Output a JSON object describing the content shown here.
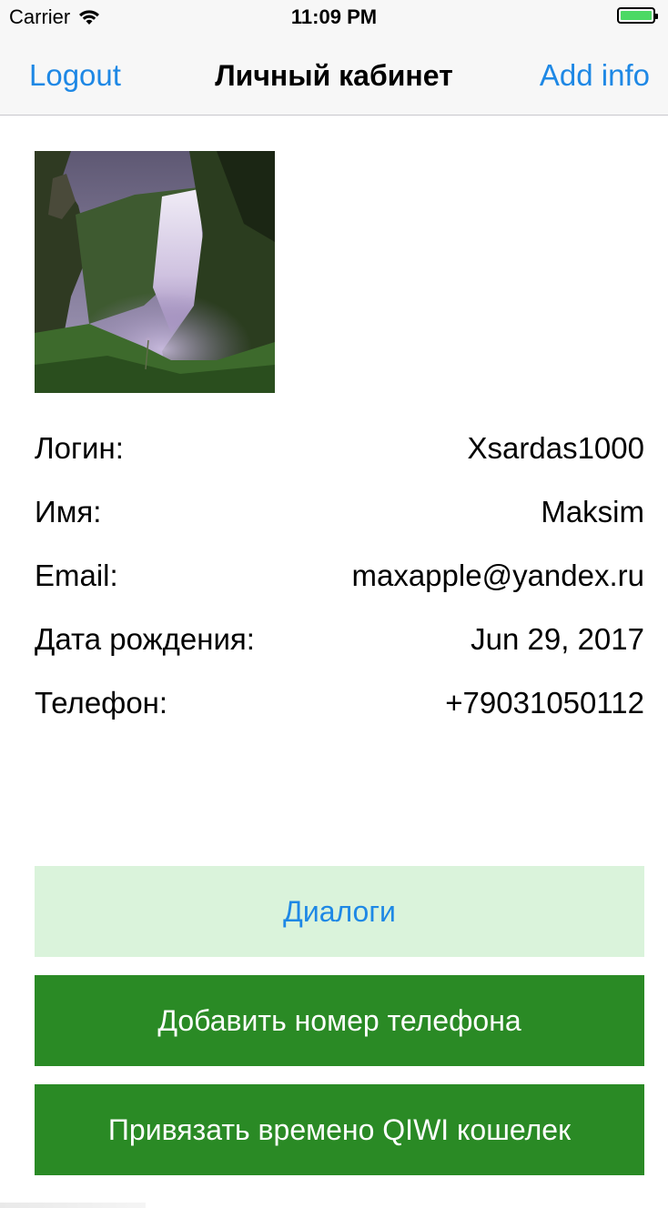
{
  "status_bar": {
    "carrier": "Carrier",
    "time": "11:09 PM",
    "wifi_icon": "wifi-icon",
    "battery_icon": "battery-icon",
    "battery_color": "#4cd964"
  },
  "nav": {
    "left_button": "Logout",
    "title": "Личный кабинет",
    "right_button": "Add info",
    "accent_color": "#1e88e5"
  },
  "profile": {
    "image": "waterfall-photo",
    "fields": [
      {
        "label": "Логин:",
        "value": "Xsardas1000"
      },
      {
        "label": "Имя:",
        "value": "Maksim"
      },
      {
        "label": "Email:",
        "value": "maxapple@yandex.ru"
      },
      {
        "label": "Дата рождения:",
        "value": "Jun 29, 2017"
      },
      {
        "label": "Телефон:",
        "value": "+79031050112"
      }
    ]
  },
  "actions": {
    "dialogs": "Диалоги",
    "add_phone": "Добавить номер телефона",
    "link_qiwi": "Привязать времено QIWI кошелек",
    "dialogs_bg": "#daf3db",
    "primary_bg": "#2a8a25"
  }
}
